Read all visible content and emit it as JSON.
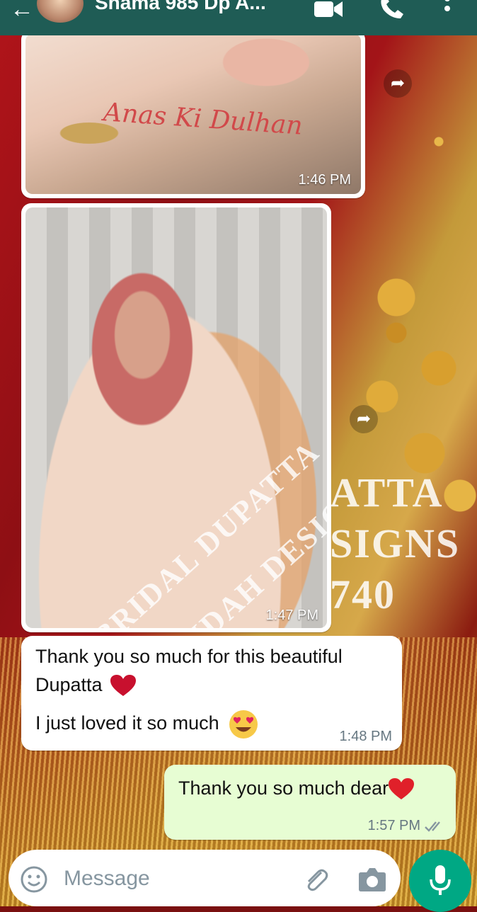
{
  "colors": {
    "header": "#1f5c55",
    "incoming_bubble": "#ffffff",
    "outgoing_bubble": "#e7fdd3",
    "timestamp": "#667781",
    "mic_button": "#00a884"
  },
  "header": {
    "contact_name": "Shama 985 Dp A...",
    "icons": [
      "back-arrow-icon",
      "video-call-icon",
      "voice-call-icon",
      "more-options-icon"
    ]
  },
  "messages": [
    {
      "type": "image",
      "direction": "incoming",
      "caption_in_photo": "Anas Ki Dulhan",
      "time": "1:46 PM"
    },
    {
      "type": "image",
      "direction": "incoming",
      "watermark_line1": "BRIDAL DUPATTA",
      "watermark_line2": "BY RIDAH DESIGNS",
      "time": "1:47 PM"
    },
    {
      "type": "text",
      "direction": "incoming",
      "line1": "Thank you so much for this beautiful",
      "line2": "Dupatta",
      "line3": "I just loved it so much",
      "time": "1:48 PM"
    },
    {
      "type": "text",
      "direction": "outgoing",
      "text": "Thank you so much dear",
      "time": "1:57 PM",
      "status": "read"
    }
  ],
  "wallpaper_text": {
    "line1": "ATTA",
    "line2": "SIGNS",
    "line3": "740"
  },
  "composer": {
    "placeholder": "Message",
    "icons": [
      "emoji-icon",
      "attach-icon",
      "camera-icon",
      "mic-icon"
    ]
  }
}
